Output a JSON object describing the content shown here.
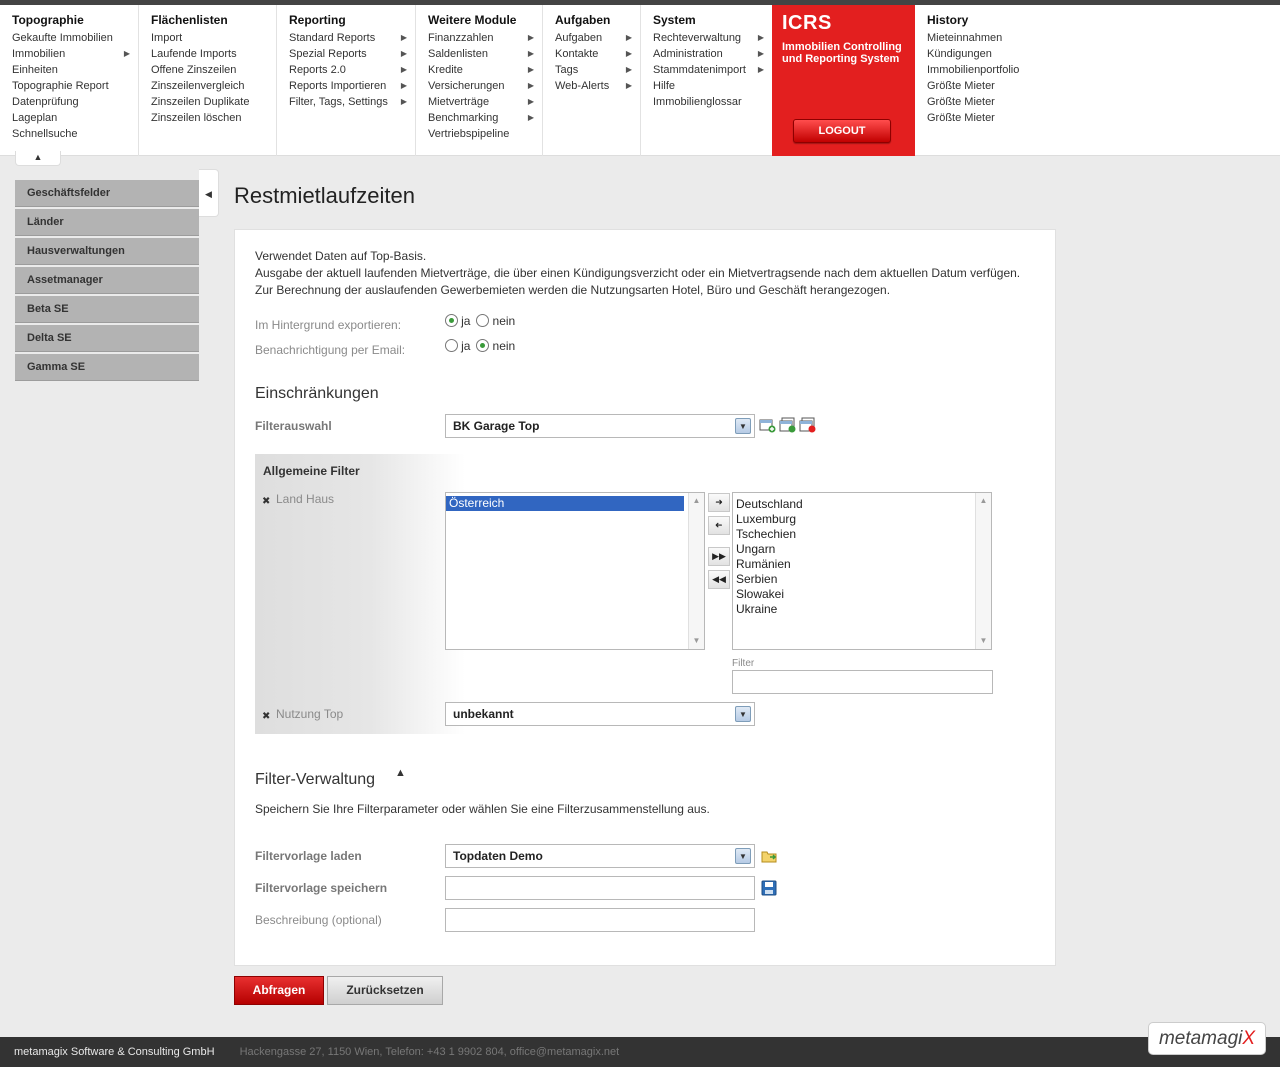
{
  "menu": {
    "columns": [
      {
        "title": "Topographie",
        "items": [
          {
            "label": "Gekaufte Immobilien",
            "sub": false
          },
          {
            "label": "Immobilien",
            "sub": true
          },
          {
            "label": "Einheiten",
            "sub": false
          },
          {
            "label": "Topographie Report",
            "sub": false
          },
          {
            "label": "Datenprüfung",
            "sub": false
          },
          {
            "label": "Lageplan",
            "sub": false
          },
          {
            "label": "Schnellsuche",
            "sub": false
          }
        ]
      },
      {
        "title": "Flächenlisten",
        "items": [
          {
            "label": "Import",
            "sub": false
          },
          {
            "label": "Laufende Imports",
            "sub": false
          },
          {
            "label": "Offene Zinszeilen",
            "sub": false
          },
          {
            "label": "Zinszeilenvergleich",
            "sub": false
          },
          {
            "label": "Zinszeilen Duplikate",
            "sub": false
          },
          {
            "label": "Zinszeilen löschen",
            "sub": false
          }
        ]
      },
      {
        "title": "Reporting",
        "items": [
          {
            "label": "Standard Reports",
            "sub": true
          },
          {
            "label": "Spezial Reports",
            "sub": true
          },
          {
            "label": "Reports 2.0",
            "sub": true
          },
          {
            "label": "Reports Importieren",
            "sub": true
          },
          {
            "label": "Filter, Tags, Settings",
            "sub": true
          }
        ]
      },
      {
        "title": "Weitere Module",
        "items": [
          {
            "label": "Finanzzahlen",
            "sub": true
          },
          {
            "label": "Saldenlisten",
            "sub": true
          },
          {
            "label": "Kredite",
            "sub": true
          },
          {
            "label": "Versicherungen",
            "sub": true
          },
          {
            "label": "Mietverträge",
            "sub": true
          },
          {
            "label": "Benchmarking",
            "sub": true
          },
          {
            "label": "Vertriebspipeline",
            "sub": false
          }
        ]
      },
      {
        "title": "Aufgaben",
        "items": [
          {
            "label": "Aufgaben",
            "sub": true
          },
          {
            "label": "Kontakte",
            "sub": true
          },
          {
            "label": "Tags",
            "sub": true
          },
          {
            "label": "Web-Alerts",
            "sub": true
          }
        ]
      },
      {
        "title": "System",
        "items": [
          {
            "label": "Rechteverwaltung",
            "sub": true
          },
          {
            "label": "Administration",
            "sub": true
          },
          {
            "label": "Stammdatenimport",
            "sub": true
          },
          {
            "label": "Hilfe",
            "sub": false
          },
          {
            "label": "Immobilienglossar",
            "sub": false
          }
        ]
      }
    ],
    "icrs": {
      "logo": "ICRS",
      "subtitle": "Immobilien Controlling und Reporting System",
      "logout": "LOGOUT"
    },
    "history": {
      "title": "History",
      "items": [
        "Mieteinnahmen",
        "Kündigungen",
        "Immobilienportfolio",
        "Größte Mieter",
        "Größte Mieter",
        "Größte Mieter"
      ]
    }
  },
  "sidebar": {
    "items": [
      "Geschäftsfelder",
      "Länder",
      "Hausverwaltungen",
      "Assetmanager",
      "Beta SE",
      "Delta SE",
      "Gamma SE"
    ]
  },
  "page": {
    "title": "Restmietlaufzeiten",
    "intro": [
      "Verwendet Daten auf Top-Basis.",
      "Ausgabe der aktuell laufenden Mietverträge, die über einen Kündigungsverzicht oder ein Mietvertragsende nach dem aktuellen Datum verfügen.",
      "Zur Berechnung der auslaufenden Gewerbemieten werden die Nutzungsarten Hotel, Büro und Geschäft herangezogen."
    ],
    "export_label": "Im Hintergrund exportieren:",
    "email_label": "Benachrichtigung per Email:",
    "yes": "ja",
    "no": "nein",
    "export_value": "ja",
    "email_value": "nein"
  },
  "restrictions": {
    "heading": "Einschränkungen",
    "filter_label": "Filterauswahl",
    "filter_value": "BK Garage Top",
    "general_filter": "Allgemeine Filter",
    "land_label": "Land Haus",
    "selected_list": [
      "Österreich"
    ],
    "available_list": [
      "Deutschland",
      "Luxemburg",
      "Tschechien",
      "Ungarn",
      "Rumänien",
      "Serbien",
      "Slowakei",
      "Ukraine"
    ],
    "filter_field_label": "Filter",
    "nutzung_label": "Nutzung Top",
    "nutzung_value": "unbekannt"
  },
  "filter_admin": {
    "heading": "Filter-Verwaltung",
    "description": "Speichern Sie Ihre Filterparameter oder wählen Sie eine Filterzusammenstellung aus.",
    "load_label": "Filtervorlage laden",
    "load_value": "Topdaten Demo",
    "save_label": "Filtervorlage speichern",
    "desc_label": "Beschreibung (optional)"
  },
  "buttons": {
    "query": "Abfragen",
    "reset": "Zurücksetzen"
  },
  "footer": {
    "company": "metamagix Software & Consulting GmbH",
    "address": "Hackengasse 27, 1150 Wien, Telefon: +43 1 9902 804, office@metamagix.net",
    "brand": "metamagiX"
  },
  "colors": {
    "accent": "#e31f1f",
    "sidebar_item": "#b3b3b3",
    "footer": "#333333",
    "selection": "#3166c1"
  }
}
